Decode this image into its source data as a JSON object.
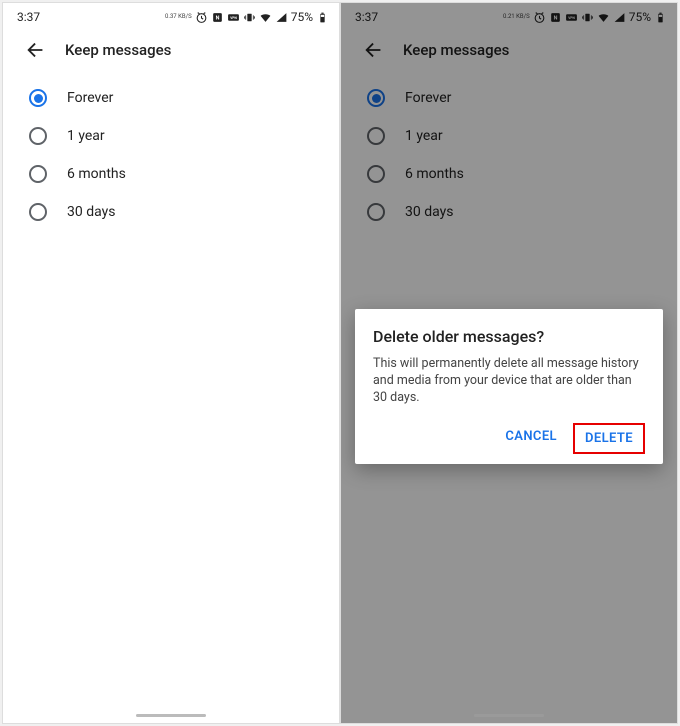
{
  "status": {
    "time": "3:37",
    "kbps_left": "0.37 KB/S",
    "kbps_right": "0.21 KB/S",
    "battery_pct": "75%"
  },
  "appbar": {
    "title": "Keep messages"
  },
  "options": [
    {
      "label": "Forever",
      "selected": true
    },
    {
      "label": "1 year",
      "selected": false
    },
    {
      "label": "6 months",
      "selected": false
    },
    {
      "label": "30 days",
      "selected": false
    }
  ],
  "dialog": {
    "title": "Delete older messages?",
    "body": "This will permanently delete all message history and media from your device that are older than 30 days.",
    "cancel": "CANCEL",
    "confirm": "DELETE"
  }
}
